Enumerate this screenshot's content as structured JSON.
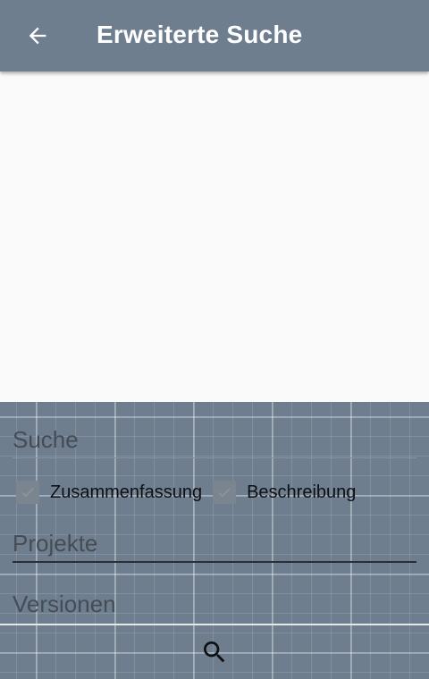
{
  "app_bar": {
    "title": "Erweiterte Suche",
    "back_icon": "arrow-left-icon",
    "background": "#6e7e8f"
  },
  "form": {
    "search": {
      "placeholder": "Suche",
      "value": ""
    },
    "checkboxes": [
      {
        "label": "Zusammenfassung",
        "checked": true
      },
      {
        "label": "Beschreibung",
        "checked": true
      }
    ],
    "projects": {
      "placeholder": "Projekte",
      "value": ""
    },
    "versions": {
      "placeholder": "Versionen",
      "value": ""
    }
  },
  "actions": {
    "search_icon": "magnifier-icon"
  }
}
